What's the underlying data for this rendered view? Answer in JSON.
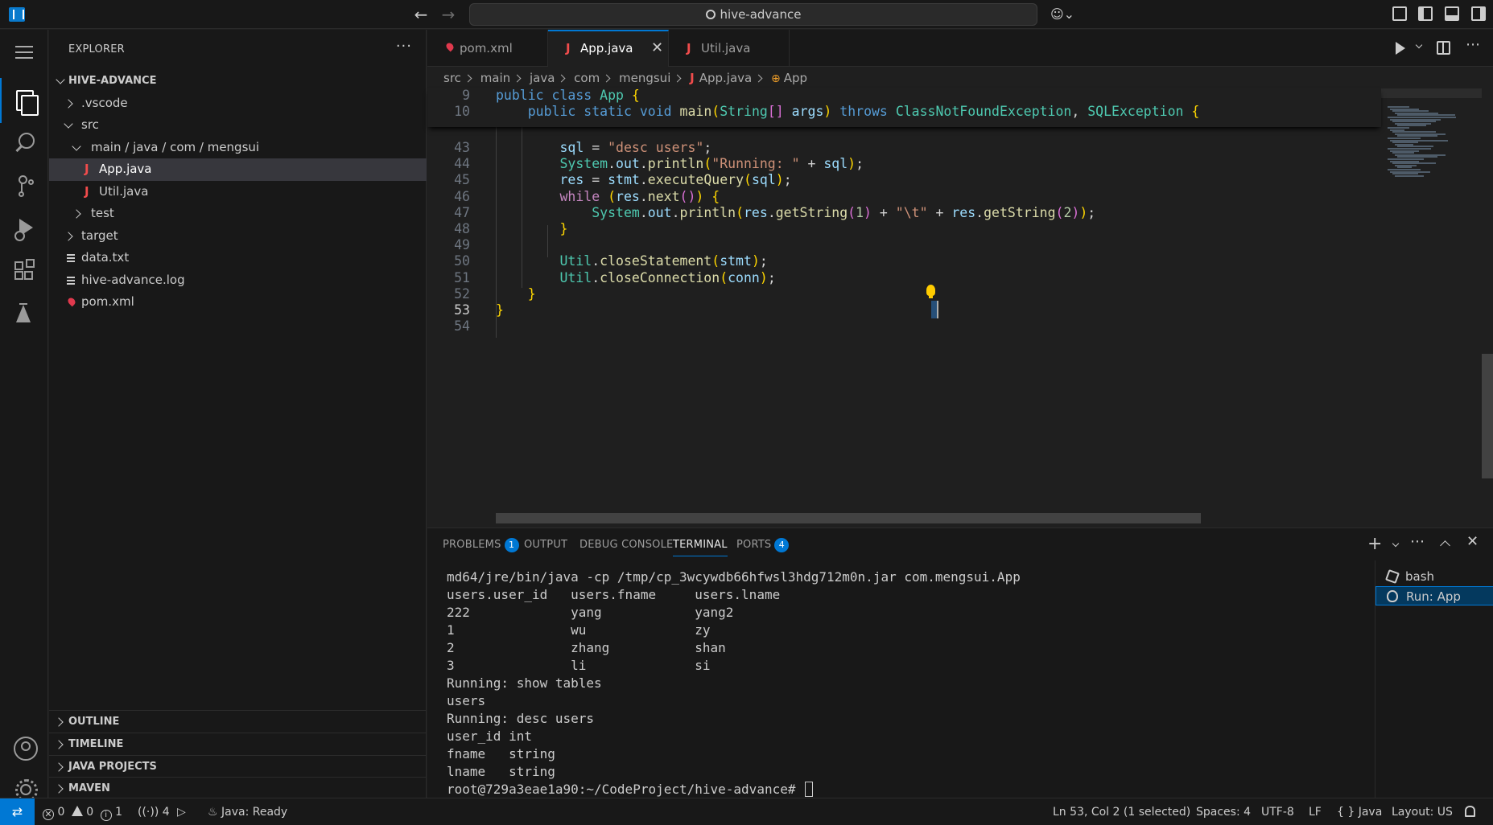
{
  "titlebar": {
    "search_text": "hive-advance"
  },
  "sidebar": {
    "title": "EXPLORER",
    "more": "···",
    "root": "HIVE-ADVANCE",
    "tree": [
      {
        "label": ".vscode",
        "type": "folder",
        "expanded": false,
        "depth": 1
      },
      {
        "label": "src",
        "type": "folder",
        "expanded": true,
        "depth": 1
      },
      {
        "label": "main",
        "type": "folder",
        "expanded": true,
        "depth": 2
      },
      {
        "label": "App.java",
        "type": "java",
        "depth": 3,
        "selected": true
      },
      {
        "label": "Util.java",
        "type": "java",
        "depth": 3
      },
      {
        "label": "test",
        "type": "folder",
        "expanded": false,
        "depth": 2
      },
      {
        "label": "target",
        "type": "folder",
        "expanded": false,
        "depth": 1
      },
      {
        "label": "data.txt",
        "type": "text",
        "depth": 1
      },
      {
        "label": "hive-advance.log",
        "type": "text",
        "depth": 1
      },
      {
        "label": "pom.xml",
        "type": "xml",
        "depth": 1
      }
    ],
    "compact_path": "main / java / com / mengsui",
    "sections": [
      "OUTLINE",
      "TIMELINE",
      "JAVA PROJECTS",
      "MAVEN"
    ]
  },
  "tabs": [
    {
      "label": "pom.xml",
      "icon": "xml-icon"
    },
    {
      "label": "App.java",
      "icon": "java-icon",
      "active": true
    },
    {
      "label": "Util.java",
      "icon": "java-icon"
    }
  ],
  "breadcrumbs": [
    "src",
    "main",
    "java",
    "com",
    "mengsui",
    "App.java",
    "App"
  ],
  "editor": {
    "sticky": [
      {
        "ln": "9",
        "code": "public class App {"
      },
      {
        "ln": "10",
        "code": "    public static void main(String[] args) throws ClassNotFoundException, SQLException {"
      }
    ],
    "lines": [
      {
        "ln": "43",
        "code": "        sql = \"desc users\";"
      },
      {
        "ln": "44",
        "code": "        System.out.println(\"Running: \" + sql);"
      },
      {
        "ln": "45",
        "code": "        res = stmt.executeQuery(sql);"
      },
      {
        "ln": "46",
        "code": "        while (res.next()) {"
      },
      {
        "ln": "47",
        "code": "            System.out.println(res.getString(1) + \"\\t\" + res.getString(2));"
      },
      {
        "ln": "48",
        "code": "        }"
      },
      {
        "ln": "49",
        "code": ""
      },
      {
        "ln": "50",
        "code": "        Util.closeStatement(stmt);"
      },
      {
        "ln": "51",
        "code": "        Util.closeConnection(conn);"
      },
      {
        "ln": "52",
        "code": "    }"
      },
      {
        "ln": "53",
        "code": "}"
      },
      {
        "ln": "54",
        "code": ""
      }
    ],
    "current_line": "53"
  },
  "panel": {
    "tabs": [
      {
        "label": "PROBLEMS",
        "badge": "1"
      },
      {
        "label": "OUTPUT"
      },
      {
        "label": "DEBUG CONSOLE"
      },
      {
        "label": "TERMINAL",
        "active": true
      },
      {
        "label": "PORTS",
        "badge": "4"
      }
    ],
    "terminal_lines": [
      "md64/jre/bin/java -cp /tmp/cp_3wcywdb66hfwsl3hdg712m0n.jar com.mengsui.App",
      "users.user_id   users.fname     users.lname",
      "222             yang            yang2",
      "1               wu              zy",
      "2               zhang           shan",
      "3               li              si",
      "Running: show tables",
      "users",
      "Running: desc users",
      "user_id int",
      "fname   string",
      "lname   string",
      "root@729a3eae1a90:~/CodeProject/hive-advance# "
    ],
    "terminals": [
      {
        "label": "bash",
        "icon": "bash-icon"
      },
      {
        "label": "Run: App",
        "icon": "debug-icon",
        "active": true
      }
    ]
  },
  "statusbar": {
    "errors": "0",
    "warnings": "0",
    "infos": "1",
    "ports": "4",
    "java_status": "Java: Ready",
    "cursor": "Ln 53, Col 2 (1 selected)",
    "spaces": "Spaces: 4",
    "encoding": "UTF-8",
    "eol": "LF",
    "language": "Java",
    "layout": "Layout: US"
  },
  "colors": {
    "accent": "#0078d4",
    "java_icon": "#f14c4c",
    "background": "#1f1f1f"
  }
}
